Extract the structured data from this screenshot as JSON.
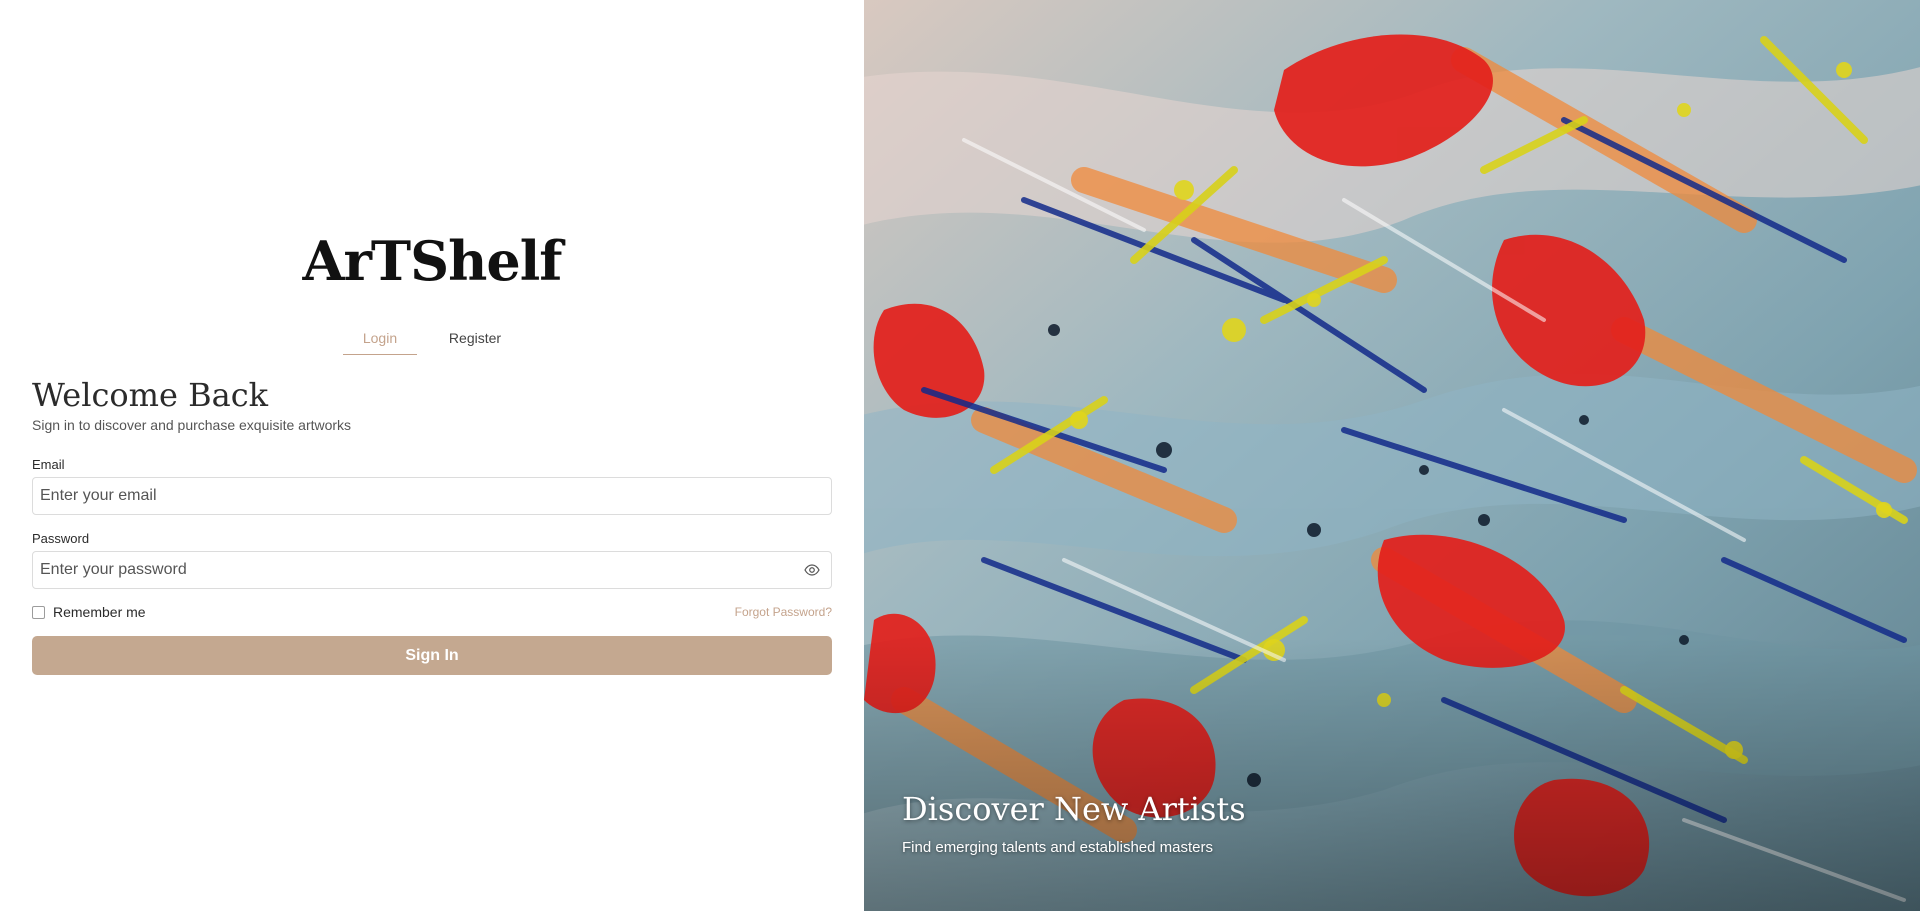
{
  "brand": {
    "logo_text": "ArTShelf"
  },
  "tabs": [
    {
      "label": "Login",
      "active": true
    },
    {
      "label": "Register",
      "active": false
    }
  ],
  "form": {
    "heading": "Welcome Back",
    "subheading": "Sign in to discover and purchase exquisite artworks",
    "email": {
      "label": "Email",
      "placeholder": "Enter your email",
      "value": ""
    },
    "password": {
      "label": "Password",
      "placeholder": "Enter your password",
      "value": "",
      "toggle_icon": "eye-icon"
    },
    "remember_label": "Remember me",
    "remember_checked": false,
    "forgot_label": "Forgot Password?",
    "submit_label": "Sign In"
  },
  "hero": {
    "title": "Discover New Artists",
    "subtitle": "Find emerging talents and established masters",
    "image": "abstract-painting"
  },
  "colors": {
    "accent": "#c4a38c",
    "button": "#c4a890",
    "text": "#2b2b2b"
  }
}
